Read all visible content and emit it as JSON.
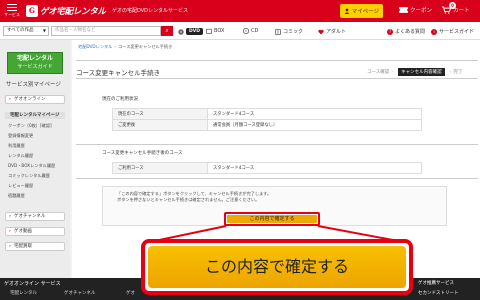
{
  "header": {
    "menu_label": "サービス",
    "logo_mark": "G",
    "logo_text": "ゲオ宅配レンタル",
    "tagline": "ゲオの宅配DVDレンタルサービス",
    "mypage_label": "マイページ",
    "coupon_label": "クーポン",
    "cart_label": "カート",
    "cart_count": "0"
  },
  "search": {
    "category_value": "すべての作品",
    "placeholder": "作品名・人物名など",
    "services": [
      "DVD",
      "BOX",
      "CD",
      "コミック",
      "アダルト"
    ],
    "help_label": "よくある質問",
    "guide_label": "サービスガイド"
  },
  "sidebar": {
    "banner_title": "宅配レンタル",
    "banner_sub": "サービスガイド",
    "section_title": "サービス別マイページ",
    "online_btn": "ゲオオンライン",
    "rental_head": "宅配レンタルマイページ",
    "links": [
      "クーポン（0枚）[確認]",
      "登録情報変更",
      "利用履歴",
      "レンタル履歴",
      "DVD・BOXレンタル履歴",
      "コミックレンタル履歴",
      "レビュー履歴",
      "宿題履歴"
    ],
    "geo_channel_btn": "ゲオチャンネル",
    "geo_douga_btn": "ゲオ動画",
    "takuhai_btn": "宅配買取"
  },
  "main": {
    "breadcrumb": [
      "宅配DVDレンタル",
      "コース変更キャンセル手続き"
    ],
    "title": "コース変更キャンセル手続き",
    "steps": [
      "コース確認",
      "キャンセル内容確認",
      "完了"
    ],
    "current_section": "現在のご利用状況",
    "current_rows": [
      {
        "k": "現在のコース",
        "v": "スタンダード4コース"
      },
      {
        "k": "ご変更後",
        "v": "通常会員（月額コース登録なし）"
      }
    ],
    "after_section": "コース変更キャンセル手続き後のコース",
    "after_rows": [
      {
        "k": "ご利用コース",
        "v": "スタンダード4コース"
      }
    ],
    "notice_line1": "「この内容で確定する」ボタンをクリックして、キャンセル手続きが完了します。",
    "notice_line2": "ボタンを押さないとキャンセル手続きは確定されません。ご注意ください。",
    "confirm_label": "この内容で確定する"
  },
  "callout": {
    "label": "この内容で確定する"
  },
  "footer": {
    "title": "ゲオオンライン サービス",
    "links": [
      "宅配レンタル",
      "ゲオチャンネル",
      "ゲオ"
    ],
    "right1": "ゲオ推薦サービス",
    "right2": "セカンドストリート"
  },
  "colors": {
    "brand_red": "#d8001a",
    "button_yellow": "#f0a800",
    "guide_green": "#45a733"
  }
}
